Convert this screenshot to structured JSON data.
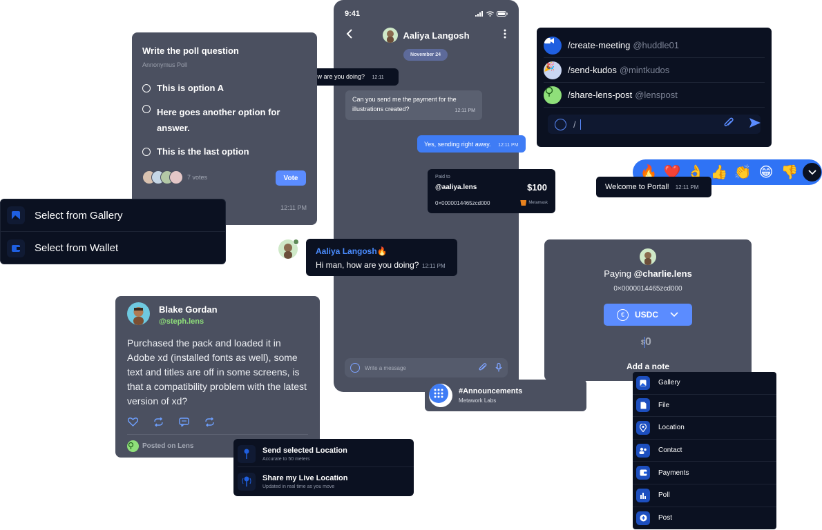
{
  "phone": {
    "time": "9:41",
    "contact_name": "Aaliya Langosh",
    "date_pill": "November 24",
    "messages": [
      {
        "text": "Hi man, how are you doing?",
        "time": "12:11 PM"
      },
      {
        "text": "Can you send me the payment for the illustrations created?",
        "time": "12:11 PM"
      },
      {
        "text": "Yes, sending right away.",
        "time": "12:11 PM"
      }
    ],
    "payment_card": {
      "paid_to_label": "Paid to",
      "handle": "@aaliya.lens",
      "amount": "$100",
      "address": "0×0000014465zcd000",
      "wallet": "Metamask"
    },
    "reply": {
      "name": "Aaliya Langosh🔥",
      "text": "Hi man, how are you doing?",
      "time": "12:11 PM"
    },
    "composer_placeholder": "Write a message"
  },
  "poll": {
    "question": "Write the poll question",
    "subtitle": "Annonymus Poll",
    "options": [
      "This is option A",
      "Here goes another option for answer.",
      "This is the last option"
    ],
    "votes": "7 votes",
    "vote_button": "Vote",
    "time": "12:11 PM"
  },
  "select_menu": {
    "items": [
      {
        "label": "Select from Gallery",
        "icon": "gallery-icon"
      },
      {
        "label": "Select from Wallet",
        "icon": "wallet-icon"
      }
    ]
  },
  "commands": {
    "items": [
      {
        "command": "/create-meeting",
        "handle": "@huddle01"
      },
      {
        "command": "/send-kudos",
        "handle": "@mintkudos"
      },
      {
        "command": "/share-lens-post",
        "handle": "@lenspost"
      }
    ],
    "input_value": "/"
  },
  "reactions": {
    "emojis": [
      "🔥",
      "❤️",
      "👌",
      "👍",
      "👏",
      "😁",
      "👎"
    ]
  },
  "welcome": {
    "text": "Welcome to Portal!",
    "time": "12:11 PM"
  },
  "post": {
    "author": "Blake Gordan",
    "handle": "@steph.lens",
    "body": "Purchased the pack and loaded it in Adobe xd (installed fonts as well), some text and titles are off in some screens, is that a compatibility problem with the latest version of xd?",
    "footer": "Posted on Lens"
  },
  "location": {
    "items": [
      {
        "title": "Send selected Location",
        "subtitle": "Accurate to 50 meters"
      },
      {
        "title": "Share my Live Location",
        "subtitle": "Updated in real time as you move"
      }
    ]
  },
  "announcement": {
    "title": "#Announcements",
    "subtitle": "Metawork Labs"
  },
  "pay": {
    "paying_label": "Paying",
    "handle": "@charlie.lens",
    "address": "0×0000014465zcd000",
    "currency": "USDC",
    "currency_symbol": "€",
    "dollar": "$",
    "amount": "0",
    "note": "Add a note"
  },
  "attach_menu": {
    "items": [
      "Gallery",
      "File",
      "Location",
      "Contact",
      "Payments",
      "Poll",
      "Post"
    ]
  },
  "colors": {
    "accent": "#5b8cff",
    "navy": "#0b1121",
    "grey": "#4b5060",
    "link": "#4a8cff",
    "green": "#8fe07a"
  }
}
